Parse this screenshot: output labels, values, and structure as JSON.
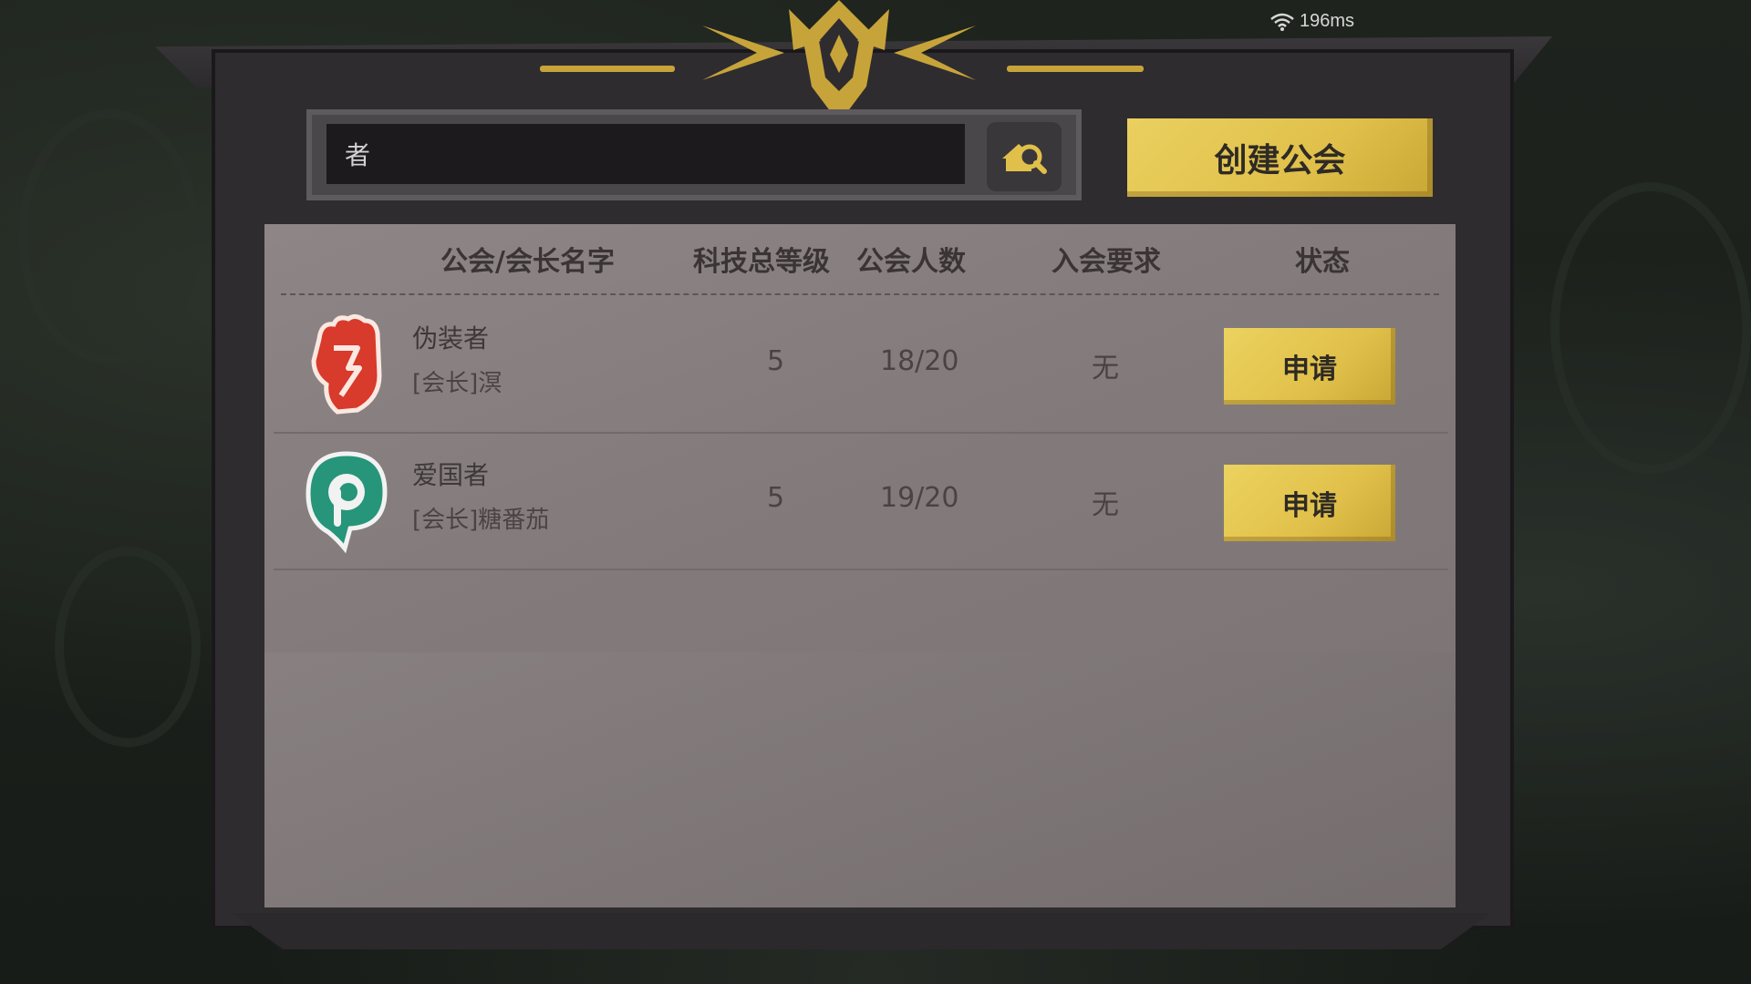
{
  "status": {
    "ping": "196ms",
    "icon": "wifi-icon"
  },
  "search": {
    "value": "者",
    "icon": "search-guild-icon"
  },
  "create_button": {
    "label": "创建公会"
  },
  "table": {
    "headers": {
      "name": "公会/会长名字",
      "tech": "科技总等级",
      "members": "公会人数",
      "requirement": "入会要求",
      "status": "状态"
    },
    "rows": [
      {
        "name": "伪装者",
        "leader": "[会长]溟",
        "tech": "5",
        "members": "18/20",
        "requirement": "无",
        "action": "申请",
        "icon": "red-fist-icon"
      },
      {
        "name": "爱国者",
        "leader": "[会长]糖番茄",
        "tech": "5",
        "members": "19/20",
        "requirement": "无",
        "action": "申请",
        "icon": "green-swirl-icon"
      }
    ]
  },
  "colors": {
    "accent": "#e0c04a",
    "panel": "#8a8282",
    "frame": "#2f2c2f"
  }
}
